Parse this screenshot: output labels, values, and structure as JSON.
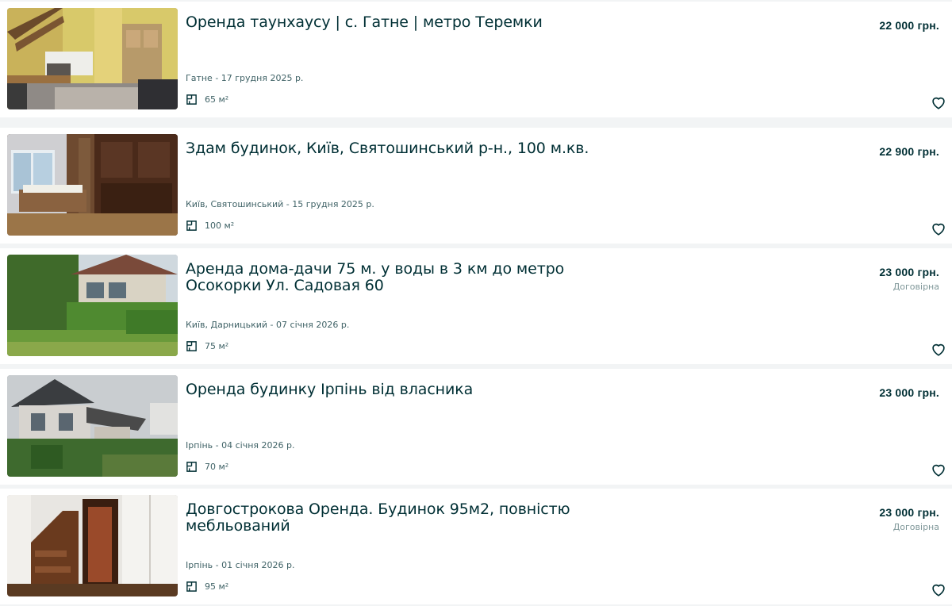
{
  "listings": [
    {
      "title": "Оренда таунхаусу | с. Гатне | метро Теремки",
      "location_date": "Гатне - 17 грудня 2025 р.",
      "area": "65 м²",
      "price": "22 000 грн.",
      "negotiable": "",
      "image": "townhouse-interior-photo"
    },
    {
      "title": "Здам будинок, Київ, Святошинський р-н., 100 м.кв.",
      "location_date": "Київ, Святошинський - 15 грудня 2025 р.",
      "area": "100 м²",
      "price": "22 900 грн.",
      "negotiable": "",
      "image": "bedroom-interior-photo"
    },
    {
      "title": "Аренда дома-дачи 75 м. у воды в 3 км до метро Осокорки Ул. Садовая 60",
      "location_date": "Київ, Дарницький - 07 січня 2026 р.",
      "area": "75 м²",
      "price": "23 000 грн.",
      "negotiable": "Договірна",
      "image": "country-house-garden-photo"
    },
    {
      "title": "Оренда будинку Ірпінь від власника",
      "location_date": "Ірпінь - 04 січня 2026 р.",
      "area": "70 м²",
      "price": "23 000 грн.",
      "negotiable": "",
      "image": "house-exterior-photo"
    },
    {
      "title": "Довгострокова Оренда. Будинок 95м2, повністю мебльований",
      "location_date": "Ірпінь - 01 січня 2026 р.",
      "area": "95 м²",
      "price": "23 000 грн.",
      "negotiable": "Договірна",
      "image": "staircase-interior-photo"
    }
  ],
  "icons": {
    "area": "floor-plan-icon",
    "favorite": "heart-outline-icon"
  },
  "colors": {
    "text": "#002f34",
    "muted": "#406367",
    "background": "#f2f4f5",
    "card": "#ffffff"
  }
}
